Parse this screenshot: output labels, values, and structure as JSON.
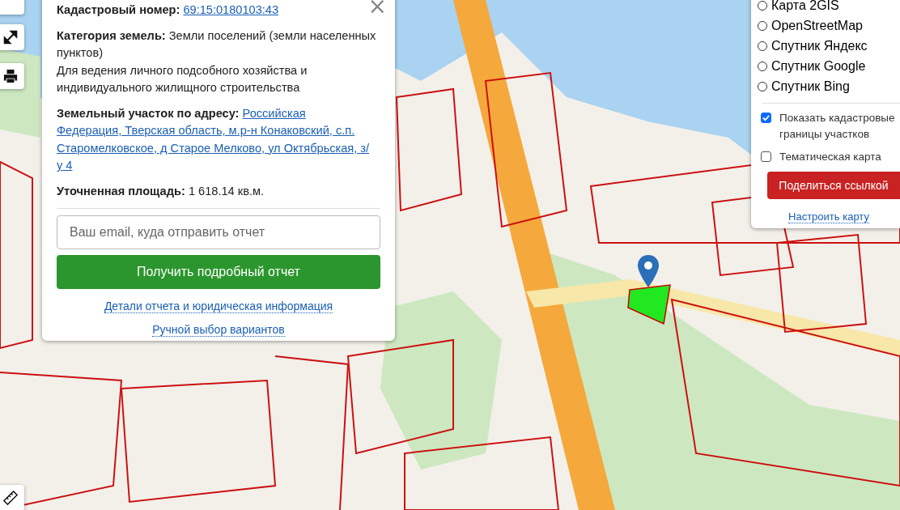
{
  "popup": {
    "close": "×",
    "fields": [
      {
        "kind": "link",
        "label": "Кадастровый номер:",
        "value": "69:15:0180103:43"
      },
      {
        "kind": "text",
        "label": "Категория земель:",
        "value": "Земли поселений (земли населенных пунктов)",
        "note": "Для ведения личного подсобного хозяйства и индивидуального жилищного строительства"
      },
      {
        "kind": "link_lines",
        "label": "Земельный участок по адресу:",
        "lines": [
          "Российская",
          "Федерация, Тверская область, м.р-н Конаковский, с.п.",
          "Старомелковское, д Старое Мелково, ул Октябрьская, з/",
          "у 4"
        ]
      },
      {
        "kind": "text",
        "label": "Уточненная площадь:",
        "value": "1 618.14 кв.м."
      }
    ],
    "email": {
      "placeholder": "Ваш email, куда отправить отчет"
    },
    "report_button": "Получить подробный отчет",
    "links": [
      "Детали отчета и юридическая информация",
      "Ручной выбор вариантов"
    ]
  },
  "layers": {
    "radios": [
      {
        "label": "Карта 2GIS",
        "selected": false
      },
      {
        "label": "OpenStreetMap",
        "selected": false
      },
      {
        "label": "Спутник Яндекс",
        "selected": false
      },
      {
        "label": "Спутник Google",
        "selected": false
      },
      {
        "label": "Спутник Bing",
        "selected": false
      }
    ],
    "checkboxes": [
      {
        "label": "Показать кадастровые границы участков",
        "checked": true
      },
      {
        "label": "Тематическая карта",
        "checked": false
      }
    ],
    "share_button": "Поделиться ссылкой",
    "settings_link": "Настроить карту"
  }
}
